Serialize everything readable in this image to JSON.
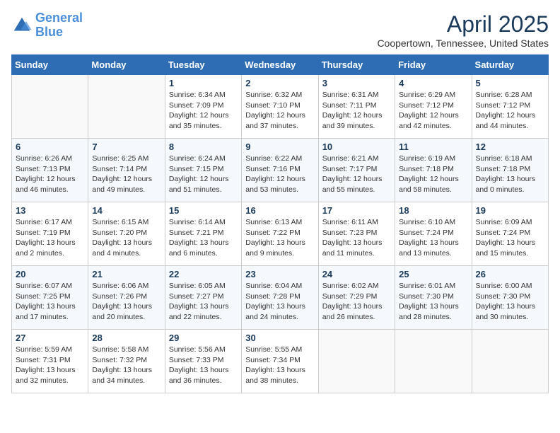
{
  "header": {
    "logo_line1": "General",
    "logo_line2": "Blue",
    "month": "April 2025",
    "location": "Coopertown, Tennessee, United States"
  },
  "weekdays": [
    "Sunday",
    "Monday",
    "Tuesday",
    "Wednesday",
    "Thursday",
    "Friday",
    "Saturday"
  ],
  "weeks": [
    [
      {
        "day": "",
        "info": ""
      },
      {
        "day": "",
        "info": ""
      },
      {
        "day": "1",
        "info": "Sunrise: 6:34 AM\nSunset: 7:09 PM\nDaylight: 12 hours\nand 35 minutes."
      },
      {
        "day": "2",
        "info": "Sunrise: 6:32 AM\nSunset: 7:10 PM\nDaylight: 12 hours\nand 37 minutes."
      },
      {
        "day": "3",
        "info": "Sunrise: 6:31 AM\nSunset: 7:11 PM\nDaylight: 12 hours\nand 39 minutes."
      },
      {
        "day": "4",
        "info": "Sunrise: 6:29 AM\nSunset: 7:12 PM\nDaylight: 12 hours\nand 42 minutes."
      },
      {
        "day": "5",
        "info": "Sunrise: 6:28 AM\nSunset: 7:12 PM\nDaylight: 12 hours\nand 44 minutes."
      }
    ],
    [
      {
        "day": "6",
        "info": "Sunrise: 6:26 AM\nSunset: 7:13 PM\nDaylight: 12 hours\nand 46 minutes."
      },
      {
        "day": "7",
        "info": "Sunrise: 6:25 AM\nSunset: 7:14 PM\nDaylight: 12 hours\nand 49 minutes."
      },
      {
        "day": "8",
        "info": "Sunrise: 6:24 AM\nSunset: 7:15 PM\nDaylight: 12 hours\nand 51 minutes."
      },
      {
        "day": "9",
        "info": "Sunrise: 6:22 AM\nSunset: 7:16 PM\nDaylight: 12 hours\nand 53 minutes."
      },
      {
        "day": "10",
        "info": "Sunrise: 6:21 AM\nSunset: 7:17 PM\nDaylight: 12 hours\nand 55 minutes."
      },
      {
        "day": "11",
        "info": "Sunrise: 6:19 AM\nSunset: 7:18 PM\nDaylight: 12 hours\nand 58 minutes."
      },
      {
        "day": "12",
        "info": "Sunrise: 6:18 AM\nSunset: 7:18 PM\nDaylight: 13 hours\nand 0 minutes."
      }
    ],
    [
      {
        "day": "13",
        "info": "Sunrise: 6:17 AM\nSunset: 7:19 PM\nDaylight: 13 hours\nand 2 minutes."
      },
      {
        "day": "14",
        "info": "Sunrise: 6:15 AM\nSunset: 7:20 PM\nDaylight: 13 hours\nand 4 minutes."
      },
      {
        "day": "15",
        "info": "Sunrise: 6:14 AM\nSunset: 7:21 PM\nDaylight: 13 hours\nand 6 minutes."
      },
      {
        "day": "16",
        "info": "Sunrise: 6:13 AM\nSunset: 7:22 PM\nDaylight: 13 hours\nand 9 minutes."
      },
      {
        "day": "17",
        "info": "Sunrise: 6:11 AM\nSunset: 7:23 PM\nDaylight: 13 hours\nand 11 minutes."
      },
      {
        "day": "18",
        "info": "Sunrise: 6:10 AM\nSunset: 7:24 PM\nDaylight: 13 hours\nand 13 minutes."
      },
      {
        "day": "19",
        "info": "Sunrise: 6:09 AM\nSunset: 7:24 PM\nDaylight: 13 hours\nand 15 minutes."
      }
    ],
    [
      {
        "day": "20",
        "info": "Sunrise: 6:07 AM\nSunset: 7:25 PM\nDaylight: 13 hours\nand 17 minutes."
      },
      {
        "day": "21",
        "info": "Sunrise: 6:06 AM\nSunset: 7:26 PM\nDaylight: 13 hours\nand 20 minutes."
      },
      {
        "day": "22",
        "info": "Sunrise: 6:05 AM\nSunset: 7:27 PM\nDaylight: 13 hours\nand 22 minutes."
      },
      {
        "day": "23",
        "info": "Sunrise: 6:04 AM\nSunset: 7:28 PM\nDaylight: 13 hours\nand 24 minutes."
      },
      {
        "day": "24",
        "info": "Sunrise: 6:02 AM\nSunset: 7:29 PM\nDaylight: 13 hours\nand 26 minutes."
      },
      {
        "day": "25",
        "info": "Sunrise: 6:01 AM\nSunset: 7:30 PM\nDaylight: 13 hours\nand 28 minutes."
      },
      {
        "day": "26",
        "info": "Sunrise: 6:00 AM\nSunset: 7:30 PM\nDaylight: 13 hours\nand 30 minutes."
      }
    ],
    [
      {
        "day": "27",
        "info": "Sunrise: 5:59 AM\nSunset: 7:31 PM\nDaylight: 13 hours\nand 32 minutes."
      },
      {
        "day": "28",
        "info": "Sunrise: 5:58 AM\nSunset: 7:32 PM\nDaylight: 13 hours\nand 34 minutes."
      },
      {
        "day": "29",
        "info": "Sunrise: 5:56 AM\nSunset: 7:33 PM\nDaylight: 13 hours\nand 36 minutes."
      },
      {
        "day": "30",
        "info": "Sunrise: 5:55 AM\nSunset: 7:34 PM\nDaylight: 13 hours\nand 38 minutes."
      },
      {
        "day": "",
        "info": ""
      },
      {
        "day": "",
        "info": ""
      },
      {
        "day": "",
        "info": ""
      }
    ]
  ]
}
